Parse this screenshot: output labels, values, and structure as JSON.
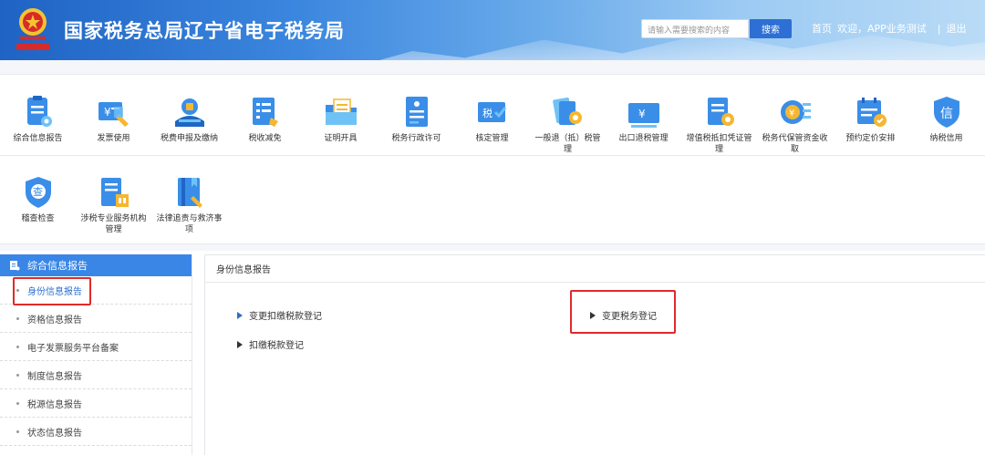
{
  "header": {
    "title": "国家税务总局辽宁省电子税务局",
    "search_placeholder": "请输入需要搜索的内容",
    "search_button": "搜索",
    "home_link": "首页",
    "welcome": "欢迎，APP业务测试",
    "separator": "|",
    "logout": "退出"
  },
  "colors": {
    "header_blue": "#2d6fd4",
    "sidebar_head": "#3a86e6",
    "highlight_red": "#e02a2a",
    "link_blue": "#2a6fcf"
  },
  "icons_row1": [
    {
      "label": "综合信息报告",
      "icon": "clipboard-icon"
    },
    {
      "label": "发票使用",
      "icon": "invoice-icon"
    },
    {
      "label": "税费申报及缴纳",
      "icon": "tax-payment-icon"
    },
    {
      "label": "税收减免",
      "icon": "tax-relief-icon"
    },
    {
      "label": "证明开具",
      "icon": "certificate-folder-icon"
    },
    {
      "label": "税务行政许可",
      "icon": "permit-document-icon"
    },
    {
      "label": "核定管理",
      "icon": "verification-icon"
    },
    {
      "label": "一般退（抵）税管理",
      "icon": "refund-icon"
    },
    {
      "label": "出口退税管理",
      "icon": "export-refund-icon"
    },
    {
      "label": "增值税抵扣凭证管理",
      "icon": "vat-voucher-icon"
    },
    {
      "label": "税务代保管资金收取",
      "icon": "custody-fund-icon"
    },
    {
      "label": "预约定价安排",
      "icon": "calendar-icon"
    },
    {
      "label": "纳税信用",
      "icon": "credit-shield-icon"
    }
  ],
  "icons_row2": [
    {
      "label": "稽查检查",
      "icon": "inspection-shield-icon"
    },
    {
      "label": "涉税专业服务机构管理",
      "icon": "service-agency-icon"
    },
    {
      "label": "法律追责与救济事项",
      "icon": "legal-book-icon"
    }
  ],
  "sidebar": {
    "title": "综合信息报告",
    "items": [
      {
        "label": "身份信息报告"
      },
      {
        "label": "资格信息报告"
      },
      {
        "label": "电子发票服务平台备案"
      },
      {
        "label": "制度信息报告"
      },
      {
        "label": "税源信息报告"
      },
      {
        "label": "状态信息报告"
      }
    ]
  },
  "main": {
    "title": "身份信息报告",
    "links": [
      {
        "label": "变更扣缴税款登记"
      },
      {
        "label": "变更税务登记"
      },
      {
        "label": "扣缴税款登记"
      }
    ]
  }
}
